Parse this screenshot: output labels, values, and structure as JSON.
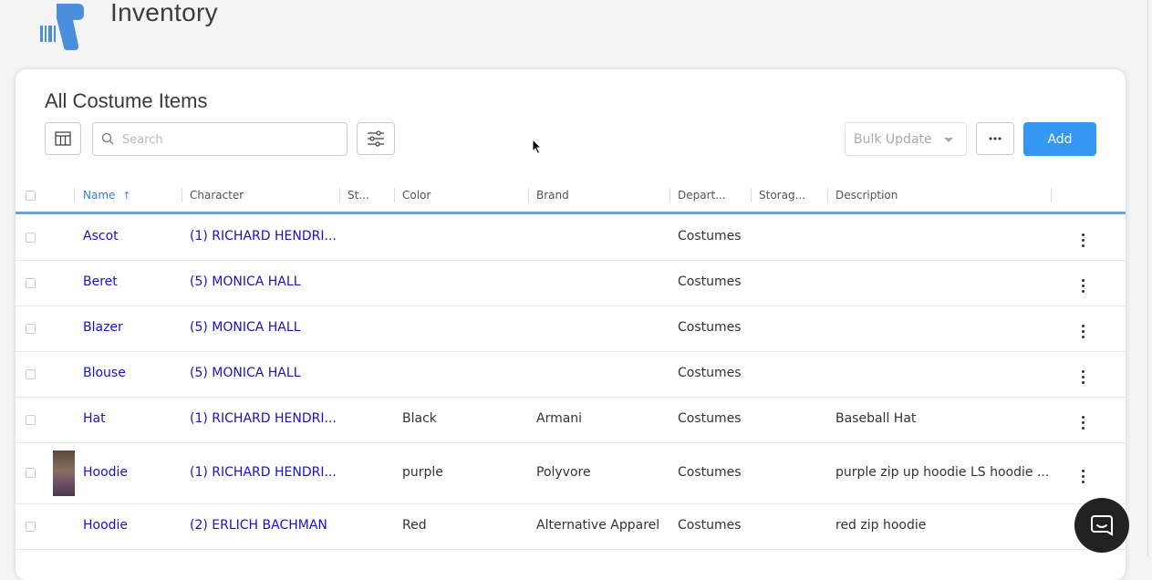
{
  "app": {
    "title": "Inventory",
    "logo_icon": "barcode-scanner-icon"
  },
  "card": {
    "title": "All Costume Items"
  },
  "toolbar": {
    "columns_icon": "table-columns-icon",
    "search_placeholder": "Search",
    "filter_icon": "sliders-icon",
    "bulk_update_label": "Bulk Update",
    "more_icon": "ellipsis-icon",
    "add_label": "Add",
    "accent_color": "#3498f0"
  },
  "table": {
    "sort_indicator": "↑",
    "columns": [
      "Name",
      "Character",
      "St...",
      "Color",
      "Brand",
      "Depart...",
      "Storag...",
      "Description"
    ],
    "rows": [
      {
        "name": "Ascot",
        "character": "(1) RICHARD HENDRI...",
        "color": "",
        "brand": "",
        "department": "Costumes",
        "description": "",
        "has_image": false
      },
      {
        "name": "Beret",
        "character": "(5) MONICA HALL",
        "color": "",
        "brand": "",
        "department": "Costumes",
        "description": "",
        "has_image": false
      },
      {
        "name": "Blazer",
        "character": "(5) MONICA HALL",
        "color": "",
        "brand": "",
        "department": "Costumes",
        "description": "",
        "has_image": false
      },
      {
        "name": "Blouse",
        "character": "(5) MONICA HALL",
        "color": "",
        "brand": "",
        "department": "Costumes",
        "description": "",
        "has_image": false
      },
      {
        "name": "Hat",
        "character": "(1) RICHARD HENDRI...",
        "color": "Black",
        "brand": "Armani",
        "department": "Costumes",
        "description": "Baseball Hat",
        "has_image": false
      },
      {
        "name": "Hoodie",
        "character": "(1) RICHARD HENDRI...",
        "color": "purple",
        "brand": "Polyvore",
        "department": "Costumes",
        "description": "purple zip up hoodie LS hoodie ...",
        "has_image": true
      },
      {
        "name": "Hoodie",
        "character": "(2) ERLICH BACHMAN",
        "color": "Red",
        "brand": "Alternative Apparel",
        "department": "Costumes",
        "description": "red zip hoodie",
        "has_image": false
      }
    ]
  },
  "chat": {
    "icon": "chat-bubble-icon"
  }
}
